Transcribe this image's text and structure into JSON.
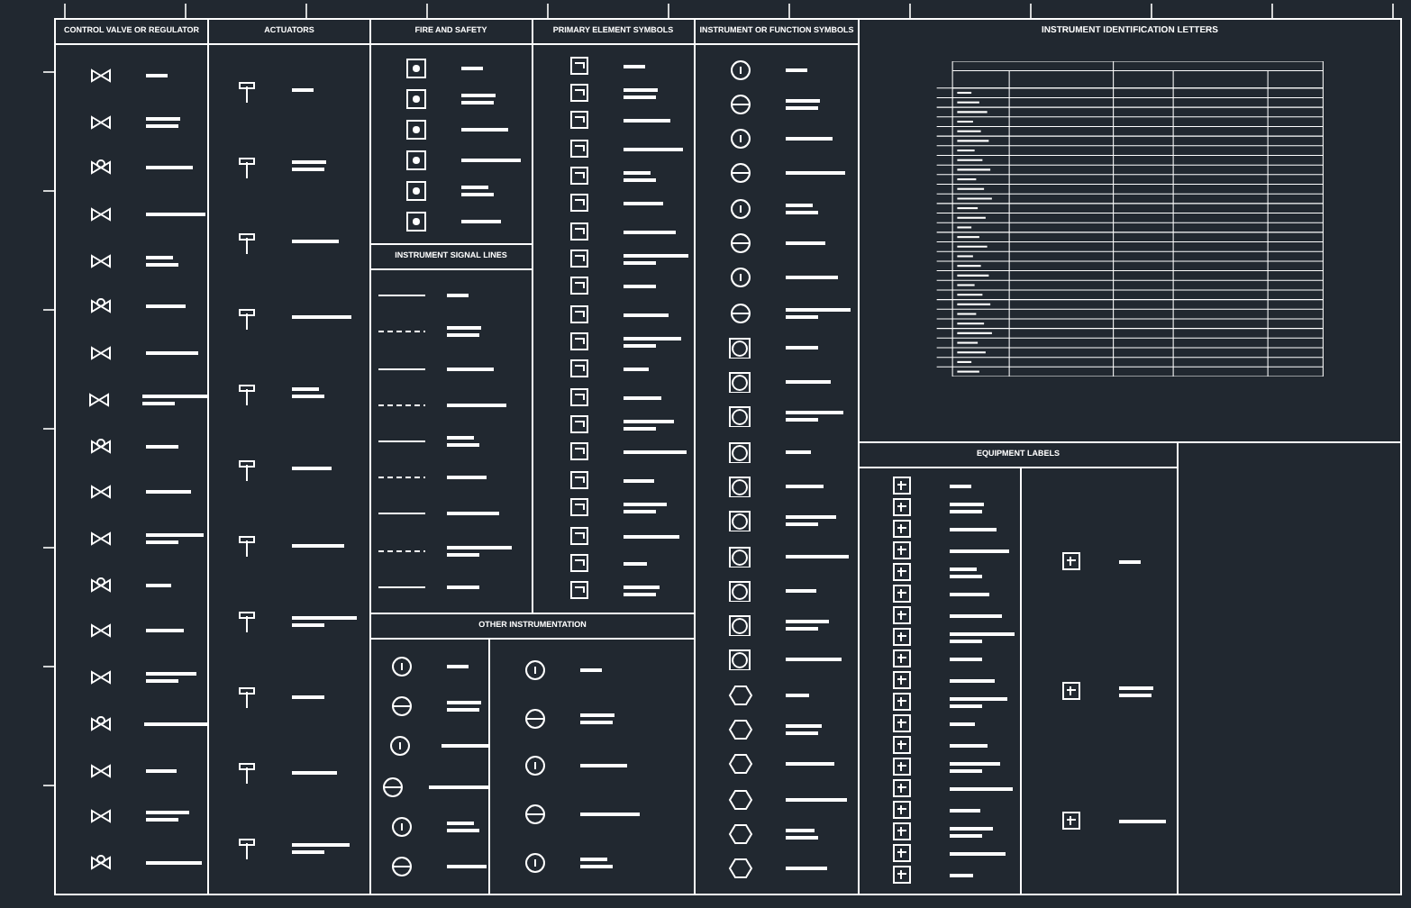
{
  "control_valves": {
    "title": "CONTROL VALVE OR REGULATOR"
  },
  "actuators": {
    "title": "ACTUATORS"
  },
  "fire_and_safety": {
    "title": "FIRE AND SAFETY"
  },
  "signal_lines": {
    "title": "INSTRUMENT SIGNAL LINES"
  },
  "primary_elements": {
    "title": "PRIMARY ELEMENT SYMBOLS"
  },
  "instrument_symbols": {
    "title": "INSTRUMENT OR FUNCTION SYMBOLS"
  },
  "other_instrumentation": {
    "title": "OTHER INSTRUMENTATION"
  },
  "identification": {
    "title": "INSTRUMENT IDENTIFICATION LETTERS"
  },
  "equipment_labels": {
    "title": "EQUIPMENT LABELS"
  }
}
